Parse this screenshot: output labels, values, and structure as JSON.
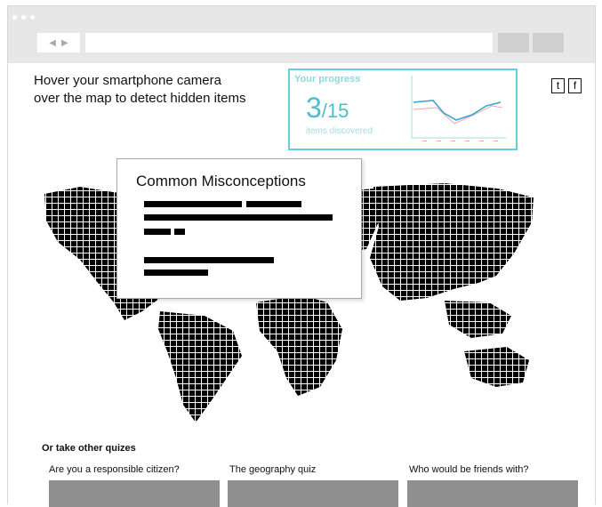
{
  "browser": {
    "back_glyph": "◀",
    "forward_glyph": "▶",
    "address_value": ""
  },
  "headline": {
    "line1": "Hover your smartphone camera",
    "line2": "over the map to detect hidden items"
  },
  "progress": {
    "title": "Your progress",
    "found": "3",
    "separator": "/",
    "total": "15",
    "label": "items discovered",
    "accent_color": "#4bbfca"
  },
  "share": {
    "twitter": "t",
    "facebook": "f"
  },
  "popup": {
    "title": "Common Misconceptions"
  },
  "quizzes": {
    "heading": "Or take other quizes",
    "items": [
      {
        "label": "Are you a responsible citizen?"
      },
      {
        "label": "The geography quiz"
      },
      {
        "label": "Who would be friends with?"
      }
    ]
  }
}
